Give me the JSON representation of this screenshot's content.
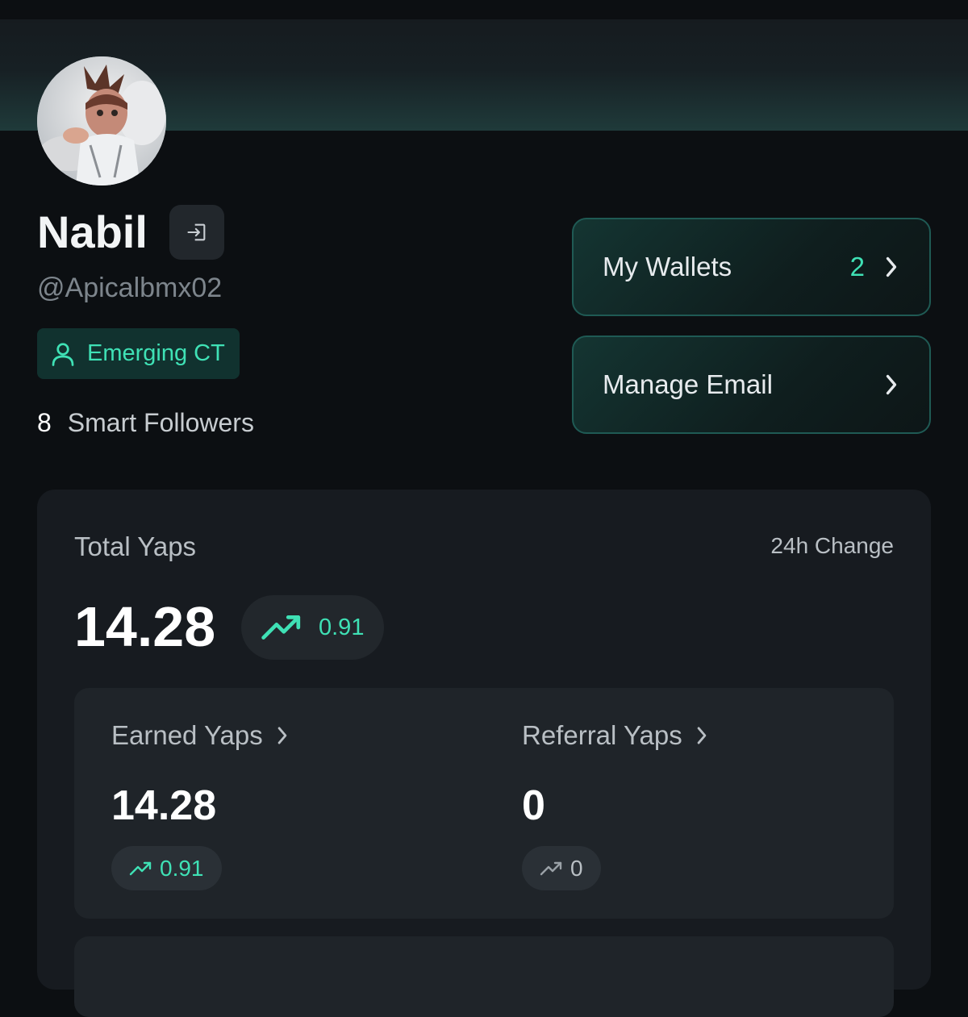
{
  "profile": {
    "name": "Nabil",
    "handle": "@Apicalbmx02",
    "tier": "Emerging CT",
    "smart_followers_count": "8",
    "smart_followers_label": "Smart Followers"
  },
  "actions": {
    "wallets_label": "My Wallets",
    "wallets_count": "2",
    "email_label": "Manage Email"
  },
  "yaps": {
    "total_label": "Total Yaps",
    "change_label": "24h Change",
    "total_value": "14.28",
    "total_change": "0.91",
    "earned": {
      "label": "Earned Yaps",
      "value": "14.28",
      "change": "0.91"
    },
    "referral": {
      "label": "Referral Yaps",
      "value": "0",
      "change": "0"
    }
  },
  "colors": {
    "accent": "#3fe1b5",
    "background": "#0c0f12",
    "card": "#171b20",
    "subcard": "#1f2429",
    "muted_text": "#7d858c"
  },
  "icons": {
    "logout": "logout-icon",
    "tier": "user-icon",
    "chevron": "chevron-right-icon",
    "trend": "trending-up-icon"
  }
}
